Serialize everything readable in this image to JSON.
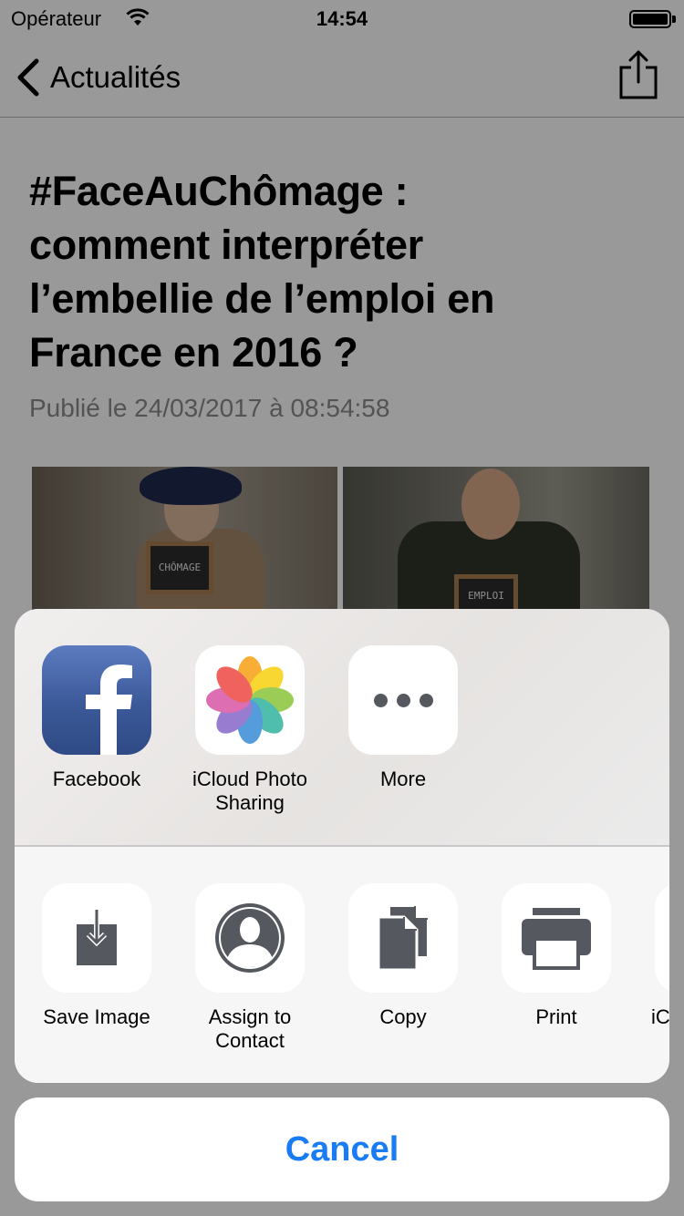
{
  "status_bar": {
    "carrier": "Opérateur",
    "time": "14:54"
  },
  "nav": {
    "back_label": "Actualités"
  },
  "article": {
    "title_lines": [
      "#FaceAuChômage :",
      "comment interpréter",
      "l’embellie de l’emploi en",
      "France en 2016 ?"
    ],
    "published": "Publié le 24/03/2017 à 08:54:58",
    "photo_left_board": "CHÔMAGE",
    "photo_right_board": "EMPLOI"
  },
  "share_sheet": {
    "apps": [
      {
        "label_line1": "Facebook",
        "label_line2": "",
        "icon": "facebook-icon"
      },
      {
        "label_line1": "iCloud Photo",
        "label_line2": "Sharing",
        "icon": "photos-icon"
      },
      {
        "label_line1": "More",
        "label_line2": "",
        "icon": "more-dots-icon"
      }
    ],
    "actions": [
      {
        "label_line1": "Save Image",
        "label_line2": "",
        "icon": "save-image-icon"
      },
      {
        "label_line1": "Assign to",
        "label_line2": "Contact",
        "icon": "contact-icon"
      },
      {
        "label_line1": "Copy",
        "label_line2": "",
        "icon": "copy-icon"
      },
      {
        "label_line1": "Print",
        "label_line2": "",
        "icon": "print-icon"
      },
      {
        "label_line1": "",
        "label_line2": "iC",
        "icon": "partial-icon"
      }
    ],
    "cancel_label": "Cancel"
  },
  "colors": {
    "accent": "#1a7cf5",
    "facebook": "#3b5998",
    "glyph": "#55595f"
  }
}
